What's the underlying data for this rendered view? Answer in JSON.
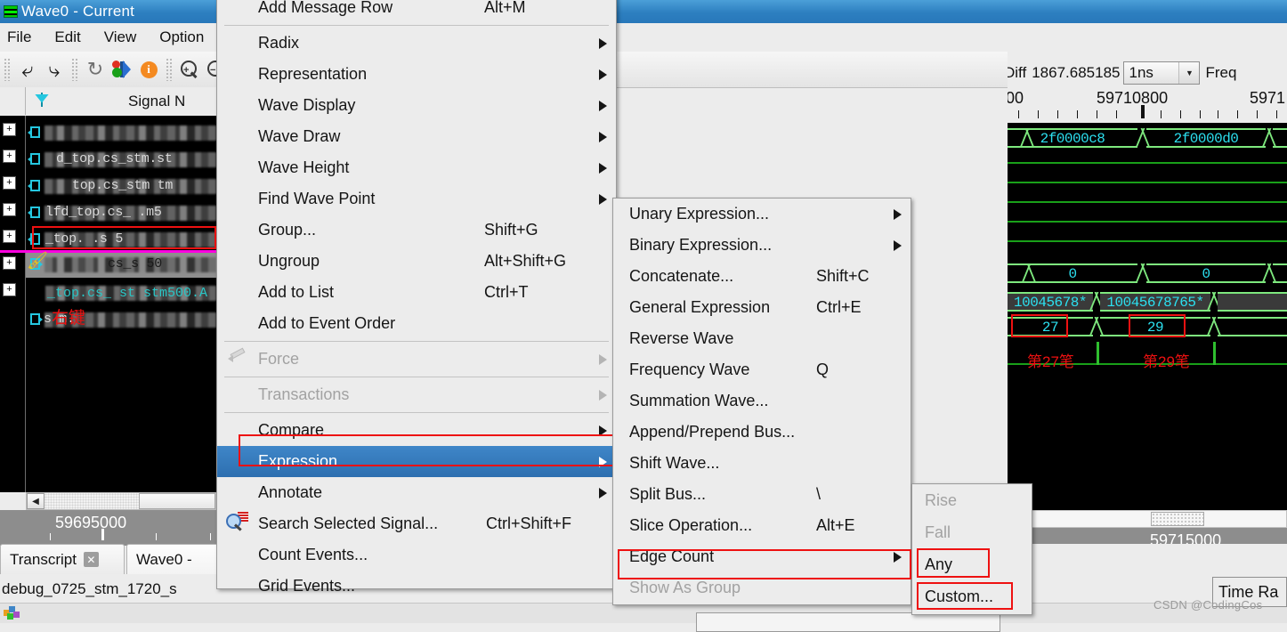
{
  "window": {
    "title": "Wave0 - Current",
    "title_icon": "wave-window-icon"
  },
  "menubar": {
    "items": [
      {
        "label": "File"
      },
      {
        "label": "Edit"
      },
      {
        "label": "View"
      },
      {
        "label": "Option"
      }
    ]
  },
  "toolbar": {
    "buttons": [
      {
        "name": "undo-icon",
        "glyph": "⤶"
      },
      {
        "name": "redo-icon",
        "glyph": "⤷"
      },
      {
        "name": "restart-icon",
        "glyph": "⟳"
      },
      {
        "name": "objects-icon",
        "glyph": ""
      },
      {
        "name": "info-icon",
        "glyph": "i"
      },
      {
        "name": "zoom-in-icon",
        "glyph": "+"
      },
      {
        "name": "zoom-out-icon",
        "glyph": "−"
      }
    ]
  },
  "wave_pane": {
    "signal_name_header": "Signal N",
    "expander_glyph": "+",
    "annotation_right_click": "右键",
    "signal_rows": [
      {
        "text": "",
        "redacted": true
      },
      {
        "text": "d_top.cs_stm.st",
        "redacted": true
      },
      {
        "text": "top.cs_stm  tm",
        "redacted": true
      },
      {
        "text": "lfd_top.cs_       .m5",
        "redacted": true
      },
      {
        "text": "_top.       .s  5",
        "redacted": true
      },
      {
        "text": "      cs_s          50",
        "redacted": true,
        "selected": true
      },
      {
        "text": "_top.cs_ st  stm500.A",
        "redacted": true,
        "teal": true
      },
      {
        "text": "s         m.",
        "redacted": true
      }
    ],
    "left_ruler_time": "59695000",
    "right_ruler_time": "59715000"
  },
  "cursor_toolbar": {
    "diff_label": "Diff",
    "diff_value": "1867.685185",
    "unit_value": "1ns",
    "freq_label": "Freq"
  },
  "chart_data": {
    "type": "timing-waveform",
    "time_axis_labels": [
      "00",
      "59710800",
      "5971"
    ],
    "rows": [
      {
        "name": "address-bus",
        "kind": "bus",
        "segments": [
          {
            "value": "2f0000c8"
          },
          {
            "value": "2f0000d0"
          }
        ]
      },
      {
        "name": "logic-lines",
        "kind": "logic",
        "count": 5
      },
      {
        "name": "zero-bus",
        "kind": "bus",
        "segments": [
          {
            "value": "0"
          },
          {
            "value": "0"
          }
        ]
      },
      {
        "name": "data-bus",
        "kind": "bus",
        "segments": [
          {
            "value": "10045678*"
          },
          {
            "value": "10045678765*"
          }
        ]
      },
      {
        "name": "count-bus",
        "kind": "bus",
        "segments": [
          {
            "value": "27",
            "highlighted": true
          },
          {
            "value": "29",
            "highlighted": true
          }
        ]
      }
    ],
    "annotations": [
      {
        "text": "第27笔",
        "color": "#ee1111"
      },
      {
        "text": "第29笔",
        "color": "#ee1111"
      }
    ]
  },
  "context_menu_main": {
    "name": "wave-context-menu",
    "items": [
      {
        "label": "Add Message Row",
        "accel": "Alt+M"
      },
      {
        "separator": true
      },
      {
        "label": "Radix",
        "submenu": true
      },
      {
        "label": "Representation",
        "submenu": true
      },
      {
        "label": "Wave Display",
        "submenu": true
      },
      {
        "label": "Wave Draw",
        "submenu": true
      },
      {
        "label": "Wave Height",
        "submenu": true
      },
      {
        "label": "Find Wave Point",
        "submenu": true
      },
      {
        "label": "Group...",
        "accel": "Shift+G"
      },
      {
        "label": "Ungroup",
        "accel": "Alt+Shift+G"
      },
      {
        "label": "Add to List",
        "accel": "Ctrl+T"
      },
      {
        "label": "Add to Event Order"
      },
      {
        "separator": true
      },
      {
        "label": "Force",
        "submenu": true,
        "disabled": true,
        "icon": "pencil-icon"
      },
      {
        "separator": true
      },
      {
        "label": "Transactions",
        "submenu": true,
        "disabled": true
      },
      {
        "separator": true
      },
      {
        "label": "Compare",
        "submenu": true
      },
      {
        "label": "Expression",
        "submenu": true,
        "highlighted": true,
        "outlined": true
      },
      {
        "label": "Annotate",
        "submenu": true
      },
      {
        "label": "Search Selected Signal...",
        "accel": "Ctrl+Shift+F",
        "icon": "search-signal-icon"
      },
      {
        "label": "Count Events..."
      },
      {
        "label": "Grid Events..."
      }
    ]
  },
  "context_menu_expression": {
    "name": "expression-submenu",
    "items": [
      {
        "label": "Unary  Expression...",
        "submenu": true
      },
      {
        "label": "Binary Expression...",
        "submenu": true
      },
      {
        "label": "Concatenate...",
        "accel": "Shift+C"
      },
      {
        "label": "General Expression",
        "accel": "Ctrl+E"
      },
      {
        "label": "Reverse Wave"
      },
      {
        "label": "Frequency Wave",
        "accel": "Q"
      },
      {
        "label": "Summation Wave..."
      },
      {
        "label": "Append/Prepend Bus..."
      },
      {
        "label": "Shift Wave..."
      },
      {
        "label": "Split Bus...",
        "accel": "\\"
      },
      {
        "label": "Slice Operation...",
        "accel": "Alt+E"
      },
      {
        "label": "Edge Count",
        "submenu": true,
        "outlined": true
      },
      {
        "label": "Show As Group",
        "disabled": true
      }
    ]
  },
  "context_menu_edge_count": {
    "name": "edge-count-submenu",
    "items": [
      {
        "label": "Rise",
        "disabled": true
      },
      {
        "label": "Fall",
        "disabled": true
      },
      {
        "label": "Any",
        "outlined": true
      },
      {
        "label": "Custom...",
        "outlined": true
      }
    ]
  },
  "tabs": [
    {
      "label": "Transcript",
      "closable": true,
      "active": false
    },
    {
      "label": "Wave0 -",
      "closable": false,
      "active": true
    }
  ],
  "status": {
    "text": "debug_0725_stm_1720_s"
  },
  "time_range_popup": {
    "label": "Time Ra"
  },
  "watermark": {
    "text": "CSDN @CodingCos"
  },
  "colors": {
    "title_bar": "#2d7fc0",
    "menu_highlight": "#3f86c8",
    "annotation_red": "#ee1111",
    "wave_green": "#7ee87e",
    "wave_cyan": "#2ce0f0",
    "cursor_magenta": "#ff00e0"
  }
}
